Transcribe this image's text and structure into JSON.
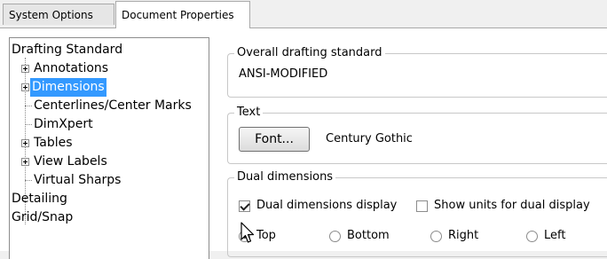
{
  "tabs": [
    {
      "label": "System Options"
    },
    {
      "label": "Document Properties"
    }
  ],
  "tree": [
    {
      "label": "Drafting Standard",
      "level": 0,
      "expandable": false
    },
    {
      "label": "Annotations",
      "level": 1,
      "expandable": true
    },
    {
      "label": "Dimensions",
      "level": 1,
      "expandable": true,
      "selected": true
    },
    {
      "label": "Centerlines/Center Marks",
      "level": 1,
      "expandable": false
    },
    {
      "label": "DimXpert",
      "level": 1,
      "expandable": false
    },
    {
      "label": "Tables",
      "level": 1,
      "expandable": true
    },
    {
      "label": "View Labels",
      "level": 1,
      "expandable": true
    },
    {
      "label": "Virtual Sharps",
      "level": 1,
      "expandable": false
    },
    {
      "label": "Detailing",
      "level": 0,
      "expandable": false
    },
    {
      "label": "Grid/Snap",
      "level": 0,
      "expandable": false
    }
  ],
  "overall": {
    "legend": "Overall drafting standard",
    "value": "ANSI-MODIFIED"
  },
  "text": {
    "legend": "Text",
    "font_button": "Font...",
    "font_name": "Century Gothic"
  },
  "dual": {
    "legend": "Dual dimensions",
    "display_label": "Dual dimensions display",
    "display_checked": true,
    "units_label": "Show units for dual display",
    "units_checked": false,
    "positions": [
      {
        "label": "Top",
        "selected": true
      },
      {
        "label": "Bottom",
        "selected": false
      },
      {
        "label": "Right",
        "selected": false
      },
      {
        "label": "Left",
        "selected": false
      }
    ]
  }
}
